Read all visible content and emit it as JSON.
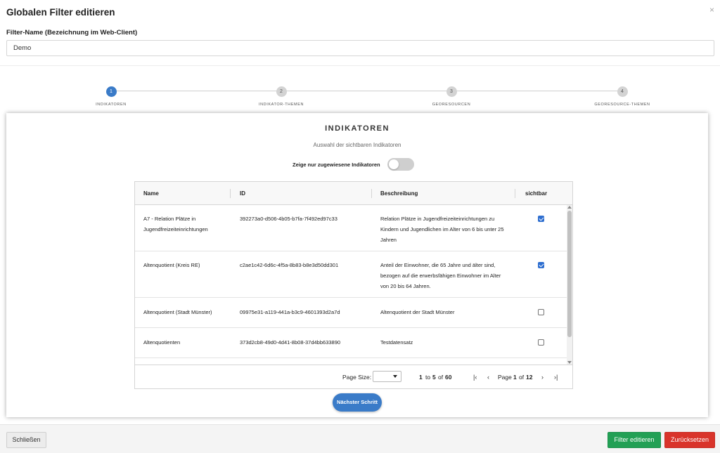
{
  "modal": {
    "title": "Globalen Filter editieren",
    "close_symbol": "×"
  },
  "filter_name": {
    "label": "Filter-Name (Bezeichnung im Web-Client)",
    "value": "Demo"
  },
  "stepper": {
    "steps": [
      {
        "number": "1",
        "label": "INDIKATOREN",
        "active": true
      },
      {
        "number": "2",
        "label": "INDIKATOR-THEMEN",
        "active": false
      },
      {
        "number": "3",
        "label": "GEORESOURCEN",
        "active": false
      },
      {
        "number": "4",
        "label": "GEORESOURCE-THEMEN",
        "active": false
      }
    ]
  },
  "section": {
    "title": "INDIKATOREN",
    "subtitle": "Auswahl der sichtbaren Indikatoren",
    "toggle_label": "Zeige nur zugewiesene Indikatoren",
    "toggle_on": false
  },
  "table": {
    "columns": [
      "Name",
      "ID",
      "Beschreibung",
      "sichtbar"
    ],
    "rows": [
      {
        "name": "A7 - Relation Plätze in Jugendfreizeiteinrichtungen",
        "id": "392273a0-d506-4b05-b7fa-7f492ed97c33",
        "description": "Relation Plätze in Jugendfreizeiteinrichtungen zu Kindern und Jugendlichen im Alter von 6 bis unter 25 Jahren",
        "visible": true
      },
      {
        "name": "Altenquotient (Kreis RE)",
        "id": "c2ae1c42-6d6c-4f5a-8b83-b8e3d50dd301",
        "description": "Anteil der Einwohner, die 65 Jahre und älter sind, bezogen auf die erwerbsfähigen Einwohner im Alter von 20 bis 64 Jahren.",
        "visible": true
      },
      {
        "name": "Altenquotient (Stadt Münster)",
        "id": "09975e31-a119-441a-b3c9-4601393d2a7d",
        "description": "Altenquotient der Stadt Münster",
        "visible": false
      },
      {
        "name": "Altenquotienten",
        "id": "373d2cb8-49d0-4d41-8b08-37d4bb633890",
        "description": "Testdatensatz",
        "visible": false
      }
    ]
  },
  "pagination": {
    "page_size_label": "Page Size:",
    "page_size_value": "",
    "range_start": "1",
    "range_to": "to",
    "range_end": "5",
    "range_of": "of",
    "total": "60",
    "page_label": "Page",
    "current_page": "1",
    "page_of": "of",
    "total_pages": "12",
    "first_symbol": "|‹",
    "prev_symbol": "‹",
    "next_symbol": "›",
    "last_symbol": "›|"
  },
  "next_step_button": "Nächster Schritt",
  "footer": {
    "close_label": "Schließen",
    "edit_label": "Filter editieren",
    "reset_label": "Zurücksetzen"
  },
  "colors": {
    "primary": "#3a7bc8",
    "success": "#22a055",
    "danger": "#d9342b",
    "checkbox": "#2f6fd0"
  }
}
